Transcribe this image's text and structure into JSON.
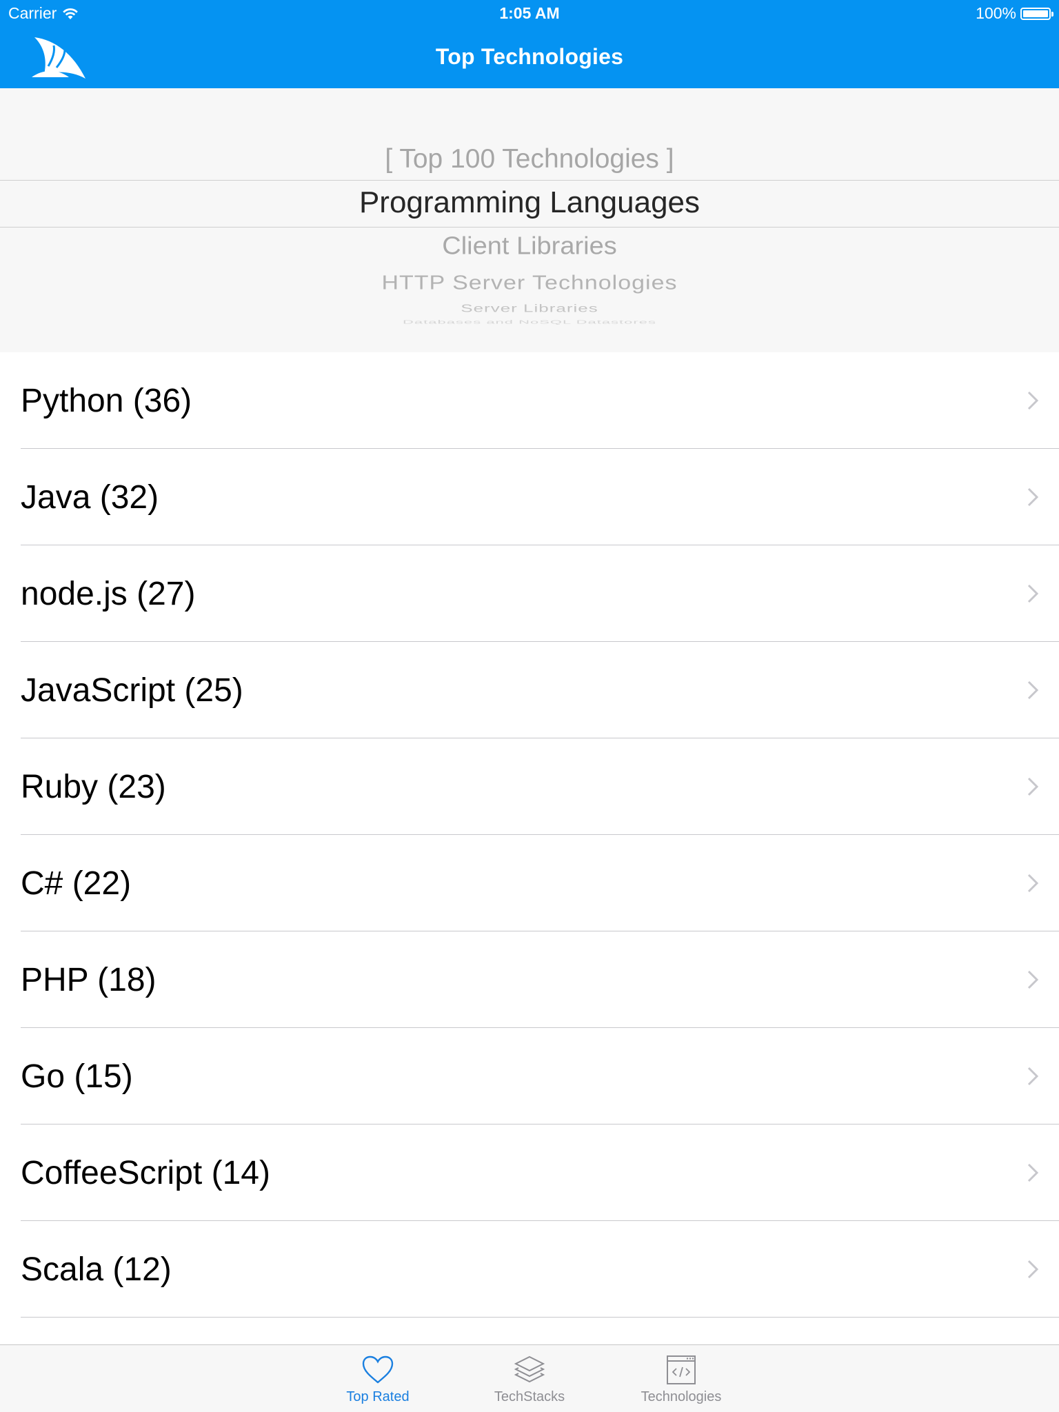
{
  "status_bar": {
    "carrier": "Carrier",
    "time": "1:05 AM",
    "battery": "100%"
  },
  "nav": {
    "title": "Top Technologies",
    "logo_icon": "shark-fin-logo-icon"
  },
  "picker": {
    "items": [
      "[ Top 100 Technologies ]",
      "Programming Languages",
      "Client Libraries",
      "HTTP Server Technologies",
      "Server Libraries",
      "Databases and NoSQL Datastores"
    ],
    "selected_index": 1
  },
  "list": {
    "items": [
      {
        "label": "Python (36)"
      },
      {
        "label": "Java (32)"
      },
      {
        "label": "node.js (27)"
      },
      {
        "label": "JavaScript (25)"
      },
      {
        "label": "Ruby (23)"
      },
      {
        "label": "C# (22)"
      },
      {
        "label": "PHP (18)"
      },
      {
        "label": "Go (15)"
      },
      {
        "label": "CoffeeScript (14)"
      },
      {
        "label": "Scala (12)"
      }
    ]
  },
  "tabbar": {
    "tabs": [
      {
        "label": "Top Rated",
        "icon": "heart-icon",
        "active": true
      },
      {
        "label": "TechStacks",
        "icon": "layers-icon",
        "active": false
      },
      {
        "label": "Technologies",
        "icon": "code-window-icon",
        "active": false
      }
    ]
  },
  "colors": {
    "brand_blue": "#0593f2",
    "tab_active": "#1a7fe0",
    "tab_inactive": "#8e8e93"
  }
}
